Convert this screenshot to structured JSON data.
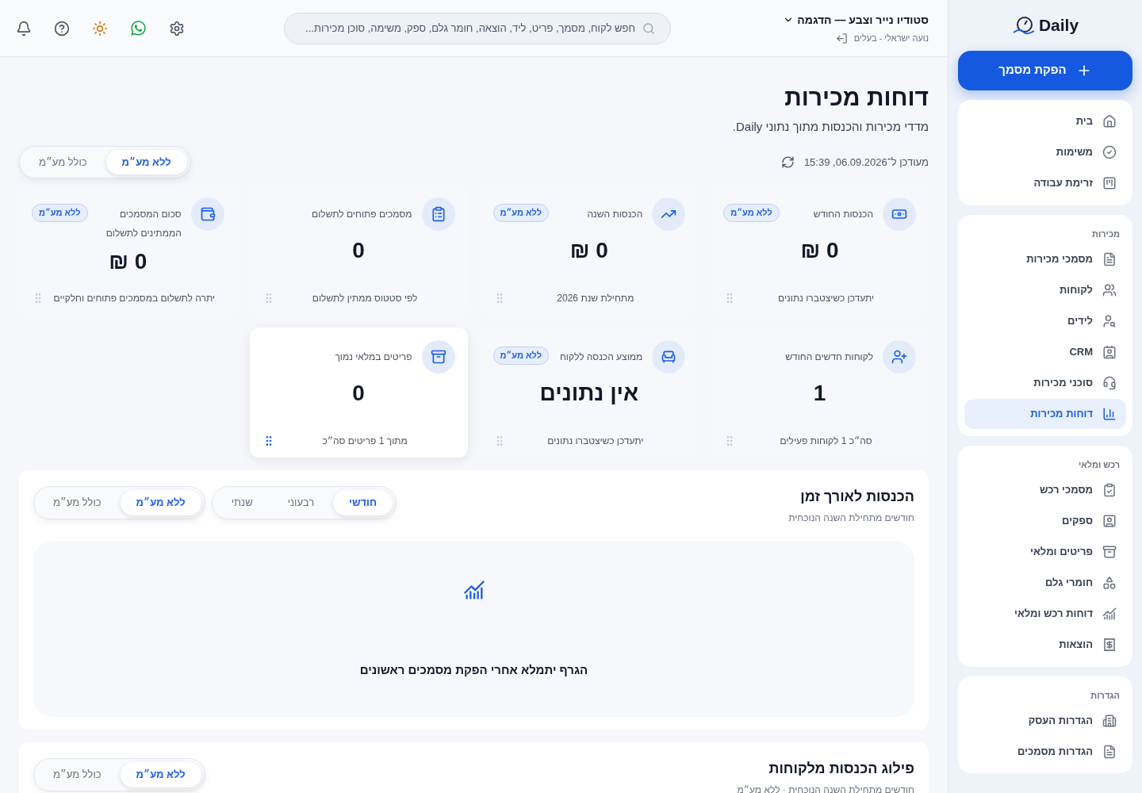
{
  "sidebar": {
    "logo": "Daily",
    "new_button": "הפקת מסמך",
    "groups": [
      {
        "items": [
          {
            "label": "בית",
            "selected": false
          },
          {
            "label": "משימות",
            "selected": false
          },
          {
            "label": "זרימת עבודה",
            "selected": false
          }
        ]
      },
      {
        "heading": "מכירות",
        "items": [
          {
            "label": "מסמכי מכירות",
            "selected": false
          },
          {
            "label": "לקוחות",
            "selected": false
          },
          {
            "label": "לידים",
            "selected": false
          },
          {
            "label": "CRM",
            "selected": false
          },
          {
            "label": "סוכני מכירות",
            "selected": false
          },
          {
            "label": "דוחות מכירות",
            "selected": true
          }
        ]
      },
      {
        "heading": "רכש ומלאי",
        "items": [
          {
            "label": "מסמכי רכש",
            "selected": false
          },
          {
            "label": "ספקים",
            "selected": false
          },
          {
            "label": "פריטים ומלאי",
            "selected": false
          },
          {
            "label": "חומרי גלם",
            "selected": false
          },
          {
            "label": "דוחות רכש ומלאי",
            "selected": false
          },
          {
            "label": "הוצאות",
            "selected": false
          }
        ]
      },
      {
        "heading": "הגדרות",
        "items": [
          {
            "label": "הגדרות העסק",
            "selected": false
          },
          {
            "label": "הגדרות מסמכים",
            "selected": false
          }
        ]
      }
    ]
  },
  "header": {
    "business": "סטודיו נייר וצבע — הדגמה",
    "user": "נועה ישראלי - בעלים",
    "search": {
      "placeholder": "חפש לקוח, מסמך, פריט, ליד, הוצאה, חומר גלם, ספק, משימה, סוכן מכירות..."
    }
  },
  "page": {
    "title": "דוחות מכירות",
    "subtitle": "מדדי מכירות והכנסות מתוך נתוני Daily.",
    "updated": "מעודכן ל־06.09.2026, 15:39",
    "vat_toggle": [
      {
        "label": "ללא מע״מ",
        "selected": true
      },
      {
        "label": "כולל מע״מ",
        "selected": false
      }
    ]
  },
  "cards": [
    {
      "title": "הכנסות החודש",
      "badge": "ללא מע״מ",
      "value": "0 ₪",
      "note": "יתעדכן כשיצטברו נתונים",
      "highlighted": false
    },
    {
      "title": "הכנסות השנה",
      "badge": "ללא מע״מ",
      "value": "0 ₪",
      "note": "מתחילת שנת 2026",
      "highlighted": false
    },
    {
      "title": "מסמכים פתוחים לתשלום",
      "value": "0",
      "note": "לפי סטטוס ממתין לתשלום",
      "highlighted": false
    },
    {
      "title": "סכום המסמכים הממתינים לתשלום",
      "badge": "ללא מע״מ",
      "value": "0 ₪",
      "note": "יתרה לתשלום במסמכים פתוחים וחלקיים",
      "highlighted": false
    },
    {
      "title": "לקוחות חדשים החודש",
      "value": "1",
      "note": "סה״כ 1 לקוחות פעילים",
      "highlighted": false
    },
    {
      "title": "ממוצע הכנסה ללקוח",
      "badge": "ללא מע״מ",
      "value": "אין נתונים",
      "note": "יתעדכן כשיצטברו נתונים",
      "highlighted": false
    },
    {
      "title": "פריטים במלאי נמוך",
      "value": "0",
      "note": "מתוך 1 פריטים סה״כ",
      "highlighted": true
    }
  ],
  "revenue_over_time": {
    "title": "הכנסות לאורך זמן",
    "subtitle": "חודשים מתחילת השנה הנוכחית",
    "periods": [
      {
        "label": "חודשי",
        "selected": true
      },
      {
        "label": "רבעוני",
        "selected": false
      },
      {
        "label": "שנתי",
        "selected": false
      }
    ],
    "vat_toggle": [
      {
        "label": "ללא מע״מ",
        "selected": true
      },
      {
        "label": "כולל מע״מ",
        "selected": false
      }
    ],
    "empty_message": "הגרף יתמלא אחרי הפקת מסמכים ראשונים"
  },
  "revenue_by_customer": {
    "title": "פילוג הכנסות מלקוחות",
    "subtitle": "חודשים מתחילת השנה הנוכחית · ללא מע״מ",
    "vat_toggle": [
      {
        "label": "ללא מע״מ",
        "selected": true
      },
      {
        "label": "כולל מע״מ",
        "selected": false
      }
    ]
  }
}
